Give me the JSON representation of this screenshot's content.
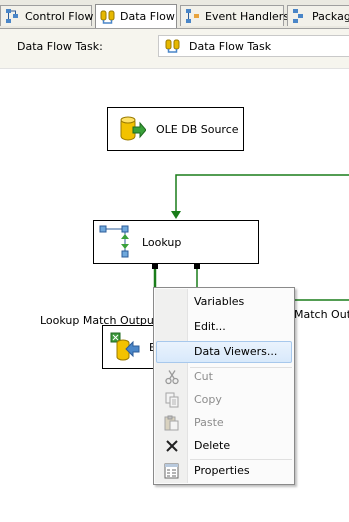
{
  "tabs": [
    {
      "label": "Control Flow",
      "icon": "control-flow-icon"
    },
    {
      "label": "Data Flow",
      "icon": "data-flow-icon",
      "active": true
    },
    {
      "label": "Event Handlers",
      "icon": "event-handlers-icon"
    },
    {
      "label": "Package",
      "icon": "package-icon"
    }
  ],
  "task": {
    "label": "Data Flow Task:",
    "value": "Data Flow Task"
  },
  "components": {
    "source": "OLE DB Source",
    "lookup": "Lookup",
    "match_output": "Lookup Match Output",
    "match_output_right": "Match Outp",
    "destination_partial": "E"
  },
  "menu": {
    "items": [
      {
        "label": "Variables",
        "enabled": true
      },
      {
        "label": "Edit...",
        "enabled": true
      },
      {
        "label": "Data Viewers...",
        "enabled": true,
        "highlighted": true
      },
      {
        "label": "Cut",
        "enabled": false,
        "icon": "cut-icon"
      },
      {
        "label": "Copy",
        "enabled": false,
        "icon": "copy-icon"
      },
      {
        "label": "Paste",
        "enabled": false,
        "icon": "paste-icon"
      },
      {
        "label": "Delete",
        "enabled": true,
        "icon": "delete-icon"
      },
      {
        "label": "Properties",
        "enabled": true,
        "icon": "properties-icon"
      }
    ]
  },
  "colors": {
    "path_green": "#1a7d1a",
    "highlight_border": "#a7c8ec"
  }
}
